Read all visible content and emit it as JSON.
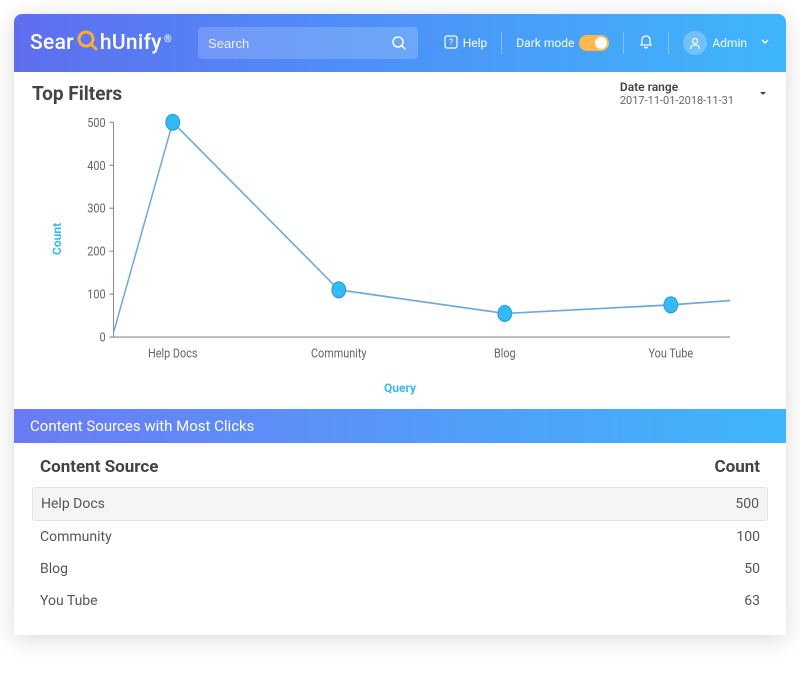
{
  "header": {
    "logo_part1": "Sear",
    "logo_part2": "hUnify",
    "logo_reg": "®",
    "search_placeholder": "Search",
    "help_label": "Help",
    "darkmode_label": "Dark mode",
    "admin_label": "Admin"
  },
  "top_filters": {
    "title": "Top Filters",
    "date_label": "Date range",
    "date_value": "2017-11-01-2018-11-31"
  },
  "section_bar_title": "Content Sources with Most Clicks",
  "table": {
    "col_source": "Content Source",
    "col_count": "Count",
    "rows": [
      {
        "source": "Help Docs",
        "count": "500"
      },
      {
        "source": "Community",
        "count": "100"
      },
      {
        "source": "Blog",
        "count": "50"
      },
      {
        "source": "You Tube",
        "count": "63"
      }
    ]
  },
  "chart_data": {
    "type": "line",
    "categories": [
      "Help Docs",
      "Community",
      "Blog",
      "You Tube"
    ],
    "values": [
      500,
      110,
      55,
      75
    ],
    "ylabel": "Count",
    "xlabel": "Query",
    "ylim": [
      0,
      500
    ],
    "yticks": [
      0,
      100,
      200,
      300,
      400,
      500
    ]
  }
}
